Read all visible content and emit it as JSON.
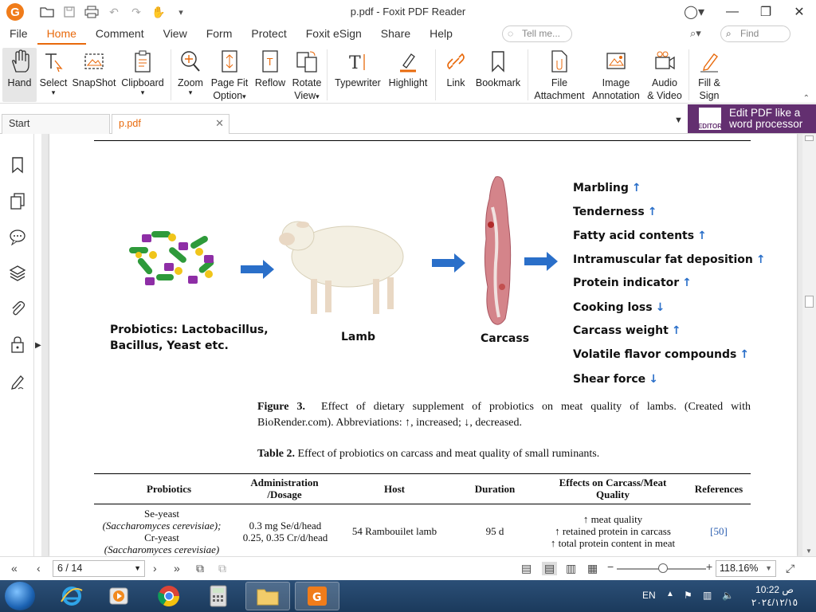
{
  "window": {
    "title": "p.pdf - Foxit PDF Reader",
    "logo_letter": "G"
  },
  "menu": {
    "items": [
      "File",
      "Home",
      "Comment",
      "View",
      "Form",
      "Protect",
      "Foxit eSign",
      "Share",
      "Help"
    ],
    "active": "Home",
    "tell_me_placeholder": "Tell me...",
    "find_placeholder": "Find"
  },
  "ribbon": {
    "hand": "Hand",
    "select": "Select",
    "snapshot": "SnapShot",
    "clipboard": "Clipboard",
    "zoom": "Zoom",
    "page_fit_1": "Page Fit",
    "page_fit_2": "Option",
    "reflow": "Reflow",
    "rotate_1": "Rotate",
    "rotate_2": "View",
    "typewriter": "Typewriter",
    "highlight": "Highlight",
    "link": "Link",
    "bookmark": "Bookmark",
    "file_attach_1": "File",
    "file_attach_2": "Attachment",
    "image_annot_1": "Image",
    "image_annot_2": "Annotation",
    "audio_1": "Audio",
    "audio_2": "& Video",
    "fill_1": "Fill &",
    "fill_2": "Sign"
  },
  "tabs": {
    "start": "Start",
    "doc": "p.pdf"
  },
  "editor_banner": {
    "line1": "Edit PDF like a",
    "line2": "word processor",
    "icon_text": "EDITOR"
  },
  "figure": {
    "probiotics_line1": "Probiotics: Lactobacillus,",
    "probiotics_line2": "Bacillus, Yeast etc.",
    "lamb": "Lamb",
    "carcass": "Carcass",
    "effects": [
      {
        "label": "Marbling",
        "arrow": "↑"
      },
      {
        "label": "Tenderness",
        "arrow": "↑"
      },
      {
        "label": "Fatty acid contents",
        "arrow": "↑"
      },
      {
        "label": "Intramuscular fat deposition",
        "arrow": "↑"
      },
      {
        "label": "Protein indicator",
        "arrow": "↑"
      },
      {
        "label": "Cooking loss",
        "arrow": "↓"
      },
      {
        "label": "Carcass weight",
        "arrow": "↑"
      },
      {
        "label": "Volatile flavor compounds",
        "arrow": "↑"
      },
      {
        "label": "Shear force",
        "arrow": "↓"
      }
    ],
    "caption_label": "Figure 3.",
    "caption_text": "Effect of dietary supplement of probiotics on meat quality of lambs. (Created with BioRender.com). Abbreviations: ↑, increased; ↓, decreased."
  },
  "table": {
    "title_label": "Table 2.",
    "title_text": "Effect of probiotics on carcass and meat quality of small ruminants.",
    "headers": {
      "probiotics": "Probiotics",
      "admin_1": "Administration",
      "admin_2": "/Dosage",
      "host": "Host",
      "duration": "Duration",
      "effects_1": "Effects on Carcass/Meat",
      "effects_2": "Quality",
      "references": "References"
    },
    "row1": {
      "probiotics_1": "Se-yeast",
      "probiotics_2": "(Saccharomyces cerevisiae);",
      "probiotics_3": "Cr-yeast",
      "probiotics_4": "(Saccharomyces cerevisiae)",
      "admin_1": "0.3 mg Se/d/head",
      "admin_2": "0.25, 0.35 Cr/d/head",
      "host": "54 Rambouilet lamb",
      "duration": "95 d",
      "effect_1": "↑ meat quality",
      "effect_2": "↑ retained protein in carcass",
      "effect_3": "↑ total protein content in meat",
      "reference": "[50]"
    }
  },
  "statusbar": {
    "page": "6 / 14",
    "zoom": "118.16%"
  },
  "taskbar": {
    "lang": "EN",
    "time": "10:22 ص",
    "date": "٢٠٢٤/١٢/١٥"
  },
  "colors": {
    "accent": "#e8690b",
    "editor_banner": "#632f70",
    "arrow_blue": "#2a6fc9"
  }
}
